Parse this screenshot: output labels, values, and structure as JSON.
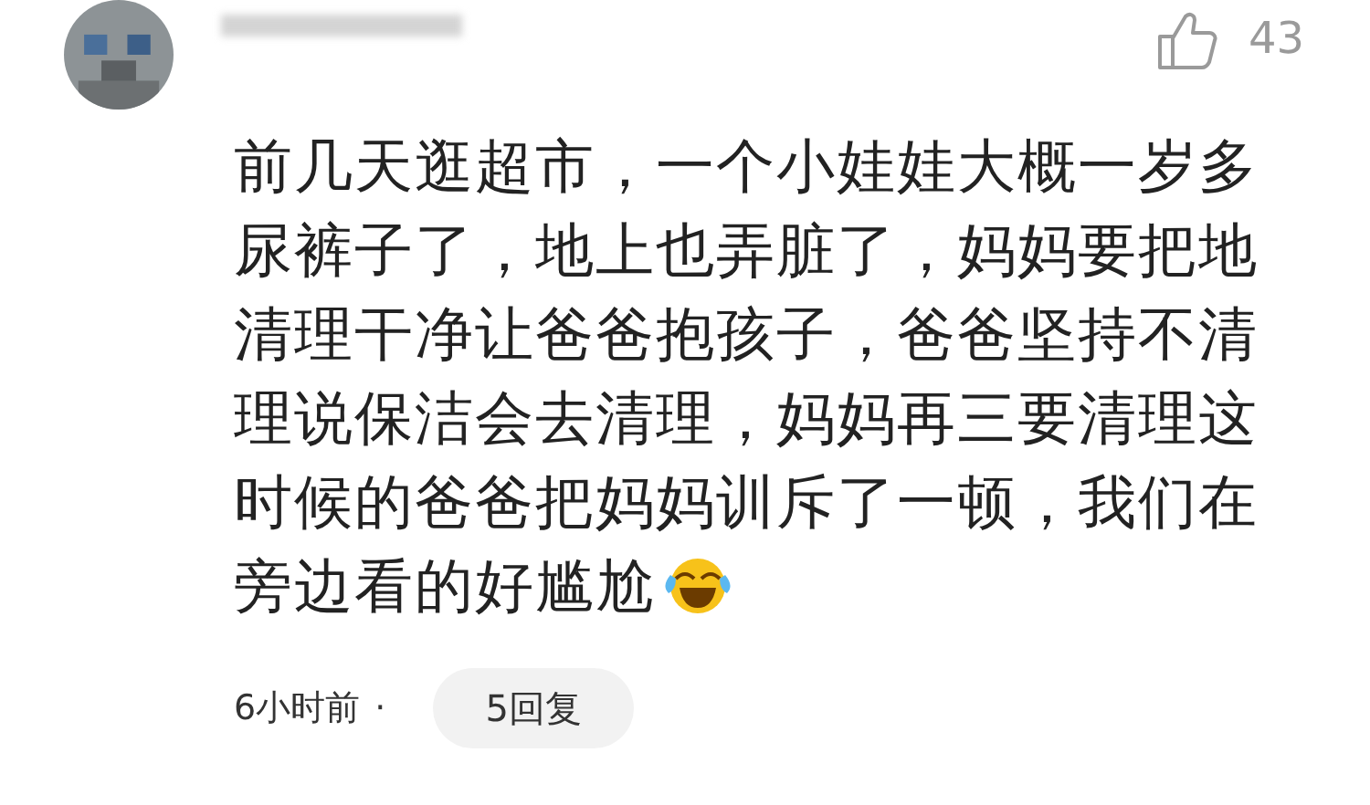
{
  "comment": {
    "likes": "43",
    "text_lines": [
      "前几天逛超市，一个小娃娃大概一岁多",
      "尿裤子了，地上也弄脏了，妈妈要把地",
      "清理干净让爸爸抱孩子，爸爸坚持不清",
      "理说保洁会去清理，妈妈再三要清理这",
      "时候的爸爸把妈妈训斥了一顿，我们在",
      "旁边看的好尴尬"
    ],
    "time": "6小时前",
    "separator": "·",
    "replies": "5回复"
  }
}
